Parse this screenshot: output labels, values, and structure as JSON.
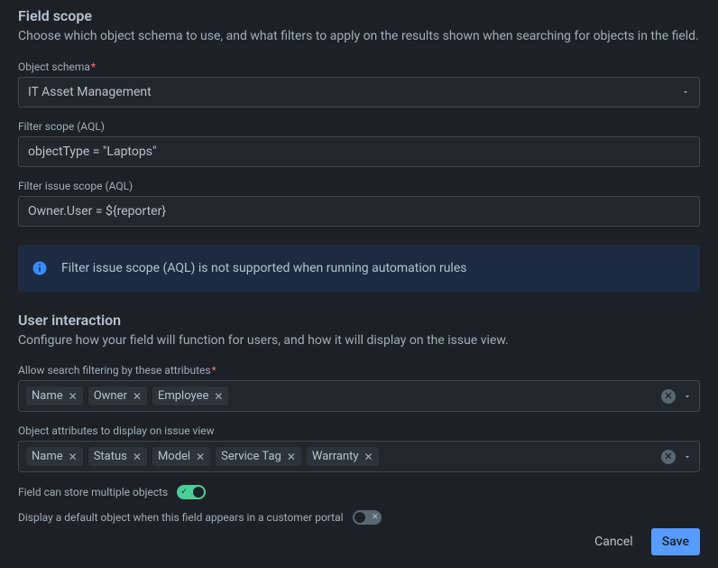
{
  "sections": {
    "fieldScope": {
      "title": "Field scope",
      "desc": "Choose which object schema to use, and what filters to apply on the results shown when searching for objects in the field."
    },
    "userInteraction": {
      "title": "User interaction",
      "desc": "Configure how your field will function for users, and how it will display on the issue view."
    }
  },
  "labels": {
    "objectSchema": "Object schema",
    "filterScope": "Filter scope (AQL)",
    "filterIssueScope": "Filter issue scope (AQL)",
    "allowSearch": "Allow search filtering by these attributes",
    "objectAttrs": "Object attributes to display on issue view",
    "multiToggle": "Field can store multiple objects",
    "defaultToggle": "Display a default object when this field appears in a customer portal"
  },
  "values": {
    "objectSchema": "IT Asset Management",
    "filterScope": "objectType = \"Laptops\"",
    "filterIssueScope": "Owner.User = ${reporter}"
  },
  "banner": {
    "text": "Filter issue scope (AQL) is not supported when running automation rules"
  },
  "searchAttrs": [
    "Name",
    "Owner",
    "Employee"
  ],
  "displayAttrs": [
    "Name",
    "Status",
    "Model",
    "Service Tag",
    "Warranty"
  ],
  "toggles": {
    "multi": true,
    "default": false
  },
  "buttons": {
    "cancel": "Cancel",
    "save": "Save"
  }
}
